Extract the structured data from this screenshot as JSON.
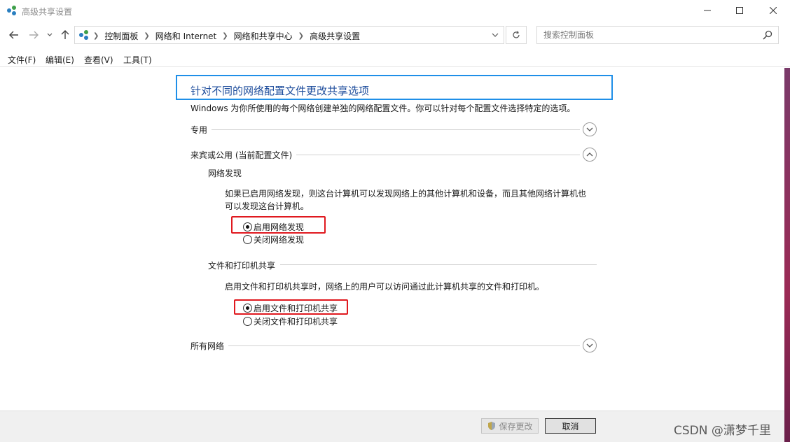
{
  "window": {
    "title": "高级共享设置"
  },
  "address": {
    "crumbs": [
      "控制面板",
      "网络和 Internet",
      "网络和共享中心",
      "高级共享设置"
    ]
  },
  "search": {
    "placeholder": "搜索控制面板"
  },
  "menu": [
    "文件(F)",
    "编辑(E)",
    "查看(V)",
    "工具(T)"
  ],
  "main": {
    "heading": "针对不同的网络配置文件更改共享选项",
    "description": "Windows 为你所使用的每个网络创建单独的网络配置文件。你可以针对每个配置文件选择特定的选项。",
    "sections": {
      "private": {
        "label": "专用",
        "expanded": false
      },
      "guest": {
        "label": "来宾或公用 (当前配置文件)",
        "expanded": true
      },
      "all": {
        "label": "所有网络",
        "expanded": false
      }
    },
    "network_discovery": {
      "title": "网络发现",
      "text_line1": "如果已启用网络发现，则这台计算机可以发现网络上的其他计算机和设备，而且其他网络计算机也",
      "text_line2": "可以发现这台计算机。",
      "options": [
        "启用网络发现",
        "关闭网络发现"
      ],
      "selected": 0
    },
    "file_printer": {
      "title": "文件和打印机共享",
      "text": "启用文件和打印机共享时，网络上的用户可以访问通过此计算机共享的文件和打印机。",
      "options": [
        "启用文件和打印机共享",
        "关闭文件和打印机共享"
      ],
      "selected": 0
    }
  },
  "footer": {
    "save_label": "保存更改",
    "cancel_label": "取消"
  },
  "watermark": "CSDN @潇梦千里",
  "colors": {
    "heading": "#1e4d9c",
    "highlight_blue": "#1f8fe8",
    "highlight_red": "#e0191f"
  }
}
